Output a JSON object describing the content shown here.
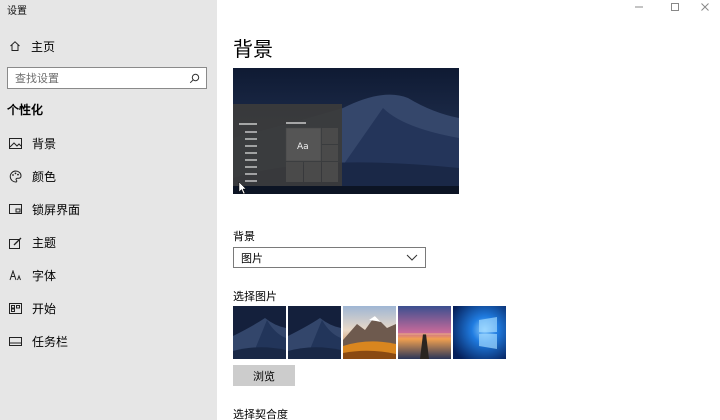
{
  "window": {
    "app_title": "设置",
    "controls": [
      "minimize-icon",
      "maximize-icon",
      "close-icon"
    ]
  },
  "sidebar": {
    "home": {
      "label": "主页",
      "icon": "home-icon"
    },
    "search": {
      "placeholder": "查找设置",
      "icon": "search-icon"
    },
    "section_title": "个性化",
    "items": [
      {
        "label": "背景",
        "icon": "picture-icon"
      },
      {
        "label": "颜色",
        "icon": "palette-icon"
      },
      {
        "label": "锁屏界面",
        "icon": "lockscreen-icon"
      },
      {
        "label": "主题",
        "icon": "theme-brush-icon"
      },
      {
        "label": "字体",
        "icon": "font-icon"
      },
      {
        "label": "开始",
        "icon": "start-icon"
      },
      {
        "label": "任务栏",
        "icon": "taskbar-icon"
      }
    ]
  },
  "main": {
    "title": "背景",
    "preview": {
      "sample_text": "Aa"
    },
    "background_label": "背景",
    "background_value": "图片",
    "choose_picture_label": "选择图片",
    "thumbnails": [
      "desert-night-dunes",
      "desert-night-dunes",
      "mountain-sunset",
      "pier-sunset",
      "windows-blue-light"
    ],
    "browse_label": "浏览",
    "fit_label": "选择契合度"
  },
  "colors": {
    "sidebar_bg": "#e6e6e6",
    "preview_sky": "#15213d",
    "button_bg": "#cccccc"
  }
}
